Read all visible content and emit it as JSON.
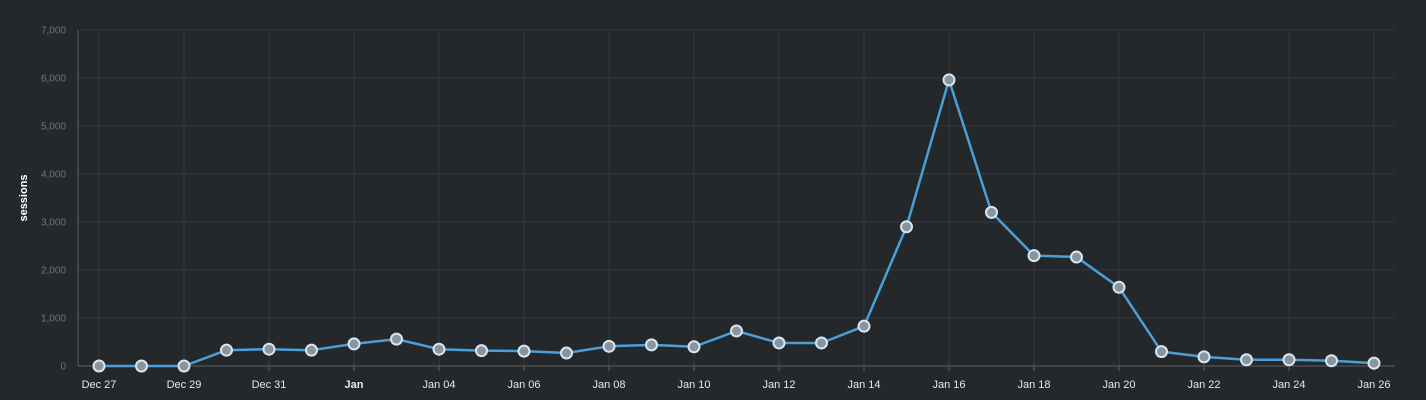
{
  "chart_data": {
    "type": "line",
    "ylabel": "sessions",
    "ylim": [
      0,
      7000
    ],
    "y_ticks": [
      "0",
      "1,000",
      "2,000",
      "3,000",
      "4,000",
      "5,000",
      "6,000",
      "7,000"
    ],
    "x_tick_labels": [
      {
        "label": "Dec 27",
        "index": 0,
        "bold": false
      },
      {
        "label": "Dec 29",
        "index": 2,
        "bold": false
      },
      {
        "label": "Dec 31",
        "index": 4,
        "bold": false
      },
      {
        "label": "Jan",
        "index": 6,
        "bold": true
      },
      {
        "label": "Jan 04",
        "index": 8,
        "bold": false
      },
      {
        "label": "Jan 06",
        "index": 10,
        "bold": false
      },
      {
        "label": "Jan 08",
        "index": 12,
        "bold": false
      },
      {
        "label": "Jan 10",
        "index": 14,
        "bold": false
      },
      {
        "label": "Jan 12",
        "index": 16,
        "bold": false
      },
      {
        "label": "Jan 14",
        "index": 18,
        "bold": false
      },
      {
        "label": "Jan 16",
        "index": 20,
        "bold": false
      },
      {
        "label": "Jan 18",
        "index": 22,
        "bold": false
      },
      {
        "label": "Jan 20",
        "index": 24,
        "bold": false
      },
      {
        "label": "Jan 22",
        "index": 26,
        "bold": false
      },
      {
        "label": "Jan 24",
        "index": 28,
        "bold": false
      },
      {
        "label": "Jan 26",
        "index": 30,
        "bold": false
      }
    ],
    "x": [
      "Dec 27",
      "Dec 28",
      "Dec 29",
      "Dec 30",
      "Dec 31",
      "Jan 01",
      "Jan 02",
      "Jan 03",
      "Jan 04",
      "Jan 05",
      "Jan 06",
      "Jan 07",
      "Jan 08",
      "Jan 09",
      "Jan 10",
      "Jan 11",
      "Jan 12",
      "Jan 13",
      "Jan 14",
      "Jan 15",
      "Jan 16",
      "Jan 17",
      "Jan 18",
      "Jan 19",
      "Jan 20",
      "Jan 21",
      "Jan 22",
      "Jan 23",
      "Jan 24",
      "Jan 25",
      "Jan 26"
    ],
    "series": [
      {
        "values": [
          0,
          0,
          0,
          330,
          350,
          330,
          460,
          560,
          350,
          320,
          310,
          270,
          410,
          440,
          400,
          730,
          480,
          480,
          830,
          2900,
          5960,
          3200,
          2300,
          2270,
          1640,
          300,
          190,
          130,
          130,
          110,
          60
        ]
      }
    ],
    "grid": true,
    "colors": {
      "line": "#4b9fd8",
      "point": "#8a949c",
      "background": "#25282b"
    }
  }
}
